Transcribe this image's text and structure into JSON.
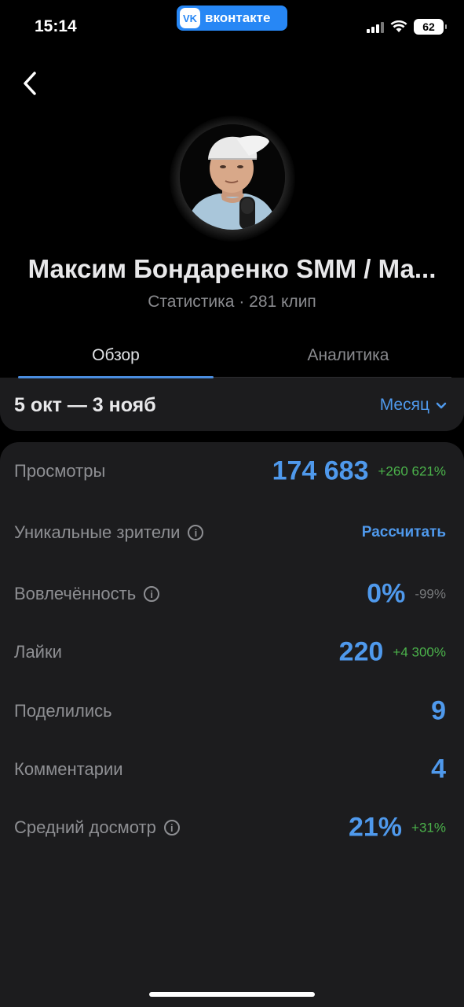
{
  "status_bar": {
    "time": "15:14",
    "app_badge": "вконтакте",
    "battery": "62"
  },
  "header": {
    "name": "Максим Бондаренко SMM / Ма...",
    "subtitle": "Статистика · 281 клип"
  },
  "tabs": [
    {
      "label": "Обзор",
      "active": true
    },
    {
      "label": "Аналитика",
      "active": false
    }
  ],
  "range": {
    "dates": "5 окт — 3 нояб",
    "period_select": "Месяц"
  },
  "stats": [
    {
      "label": "Просмотры",
      "value": "174 683",
      "delta": "+260 621%",
      "delta_dir": "up",
      "info": false
    },
    {
      "label": "Уникальные зрители",
      "action": "Рассчитать",
      "info": true
    },
    {
      "label": "Вовлечённость",
      "value": "0%",
      "delta": "-99%",
      "delta_dir": "down",
      "info": true
    },
    {
      "label": "Лайки",
      "value": "220",
      "delta": "+4 300%",
      "delta_dir": "up",
      "info": false
    },
    {
      "label": "Поделились",
      "value": "9",
      "info": false
    },
    {
      "label": "Комментарии",
      "value": "4",
      "info": false
    },
    {
      "label": "Средний досмотр",
      "value": "21%",
      "delta": "+31%",
      "delta_dir": "up",
      "info": true
    }
  ],
  "colors": {
    "accent": "#4f99ec",
    "positive": "#4bb34b",
    "negative": "#76787a",
    "card": "#1c1c1e",
    "vk_brand": "#2787f5"
  },
  "icons": [
    "back-arrow-icon",
    "info-icon",
    "chevron-down-icon",
    "signal-icon",
    "wifi-icon",
    "battery-icon",
    "vk-logo-icon"
  ]
}
